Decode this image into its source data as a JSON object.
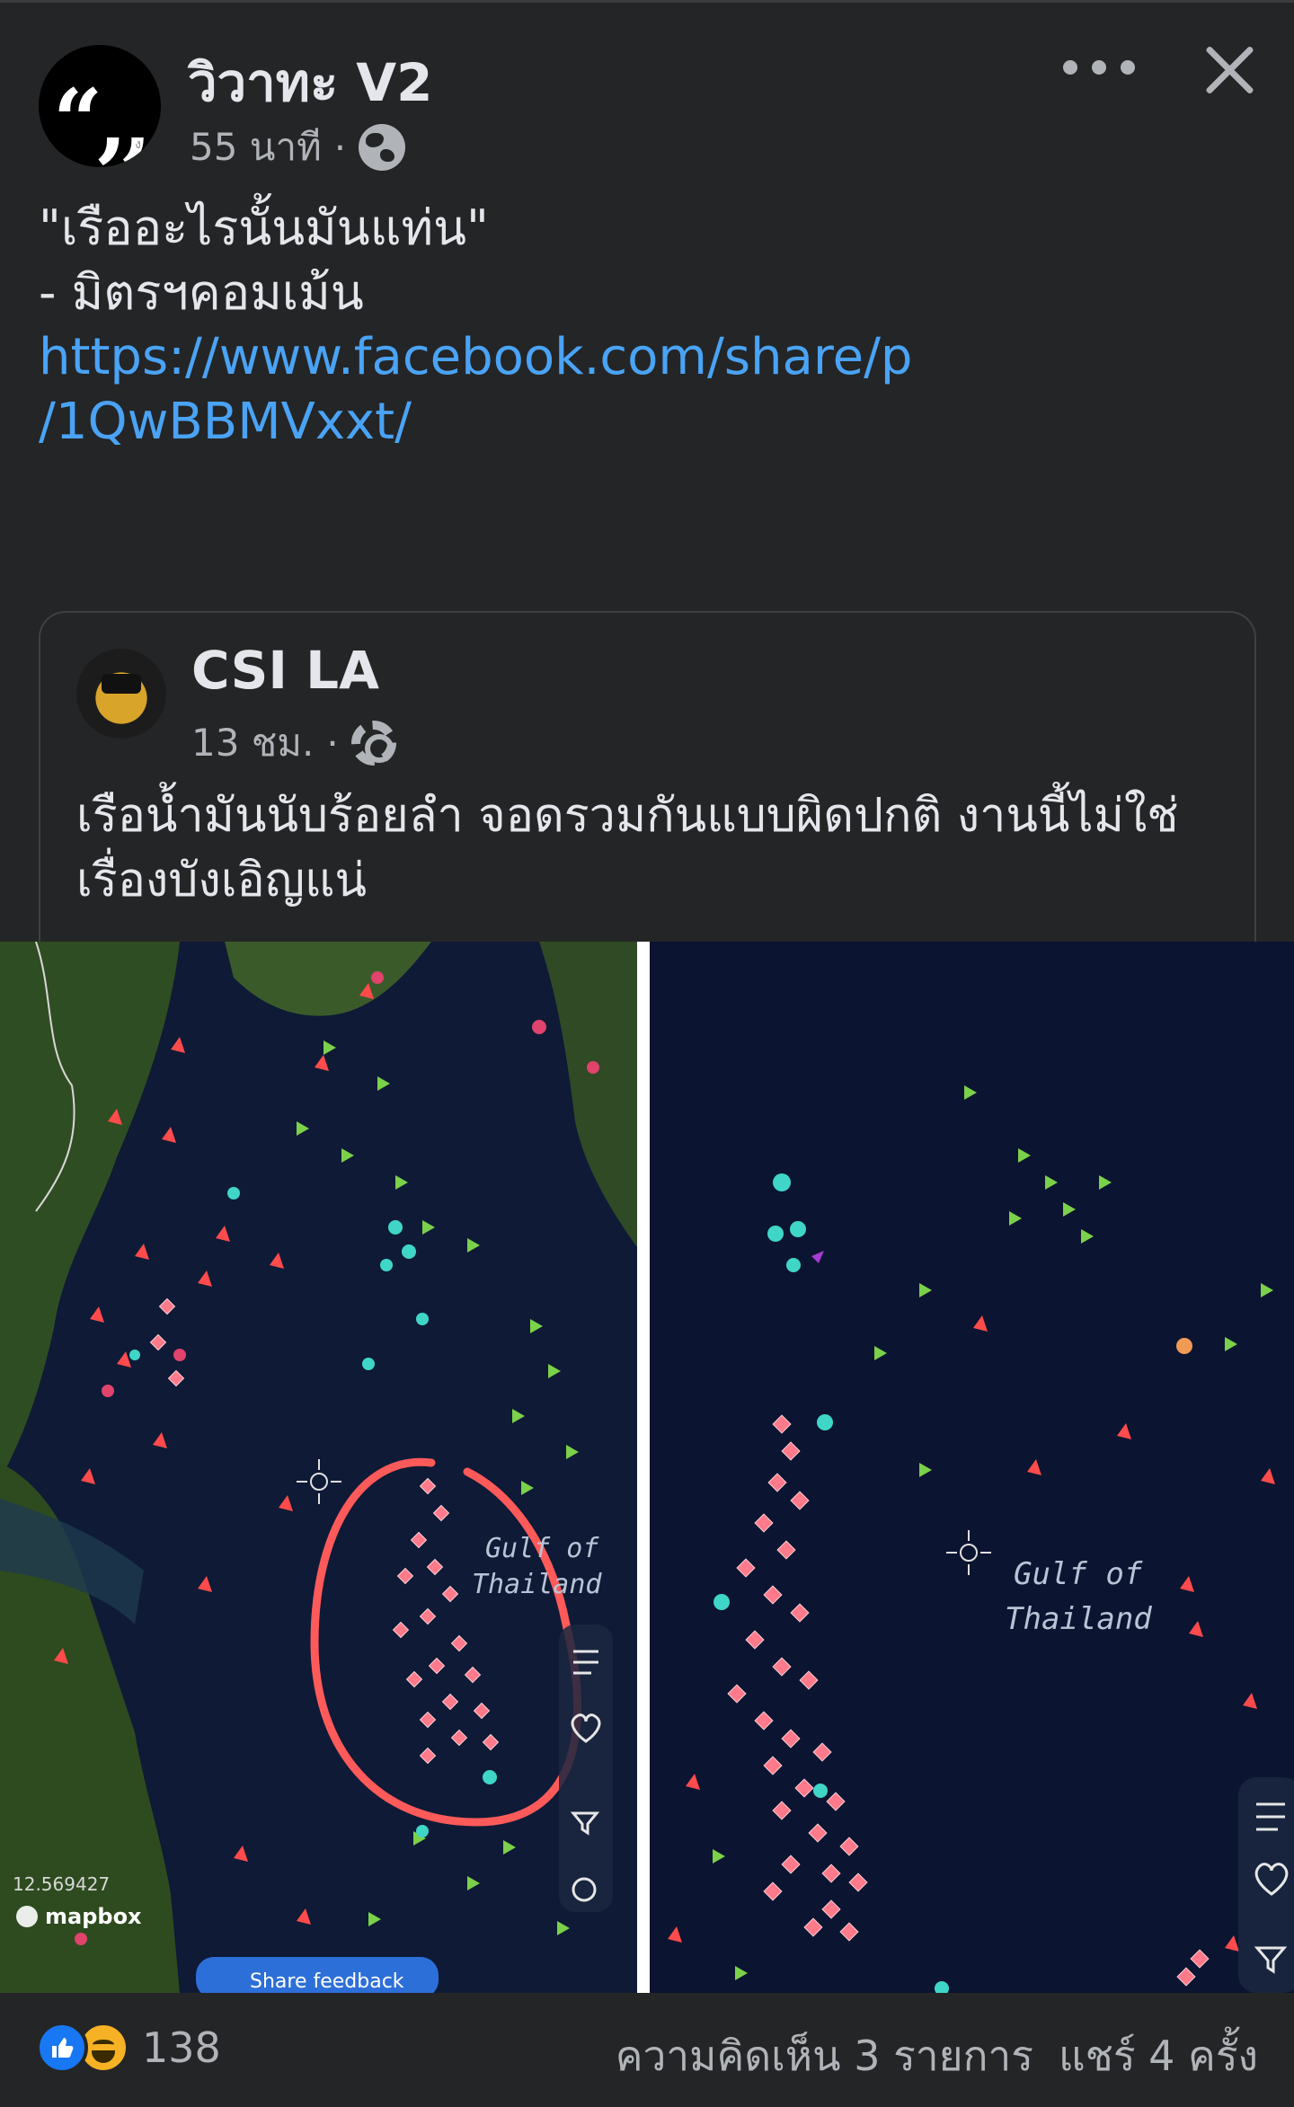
{
  "post": {
    "page_name": "วิวาทะ V2",
    "time": "55 นาที",
    "separator": "·",
    "avatar_text": "“,,",
    "body_lines": [
      "\"เรืออะไรนั้นมันแท่น\"",
      "",
      "- มิตรฯคอมเม้น",
      ""
    ],
    "link_line1": "https://www.facebook.com/share/p",
    "link_line2": "/1QwBBMVxxt/"
  },
  "shared_post": {
    "page_name": "CSI LA",
    "time": "13 ชม.",
    "separator": "·",
    "text": "เรือน้ำมันนับร้อยลำ จอดรวมกันแบบผิดปกติ งานนี้ไม่ใช่เรื่องบังเอิญแน่"
  },
  "map_left": {
    "label_line1": "Gulf of",
    "label_line2": "Thailand",
    "coordinate": "12.569427",
    "brand": "mapbox",
    "feedback_button": "Share feedback"
  },
  "map_right": {
    "label_line1": "Gulf of",
    "label_line2": "Thailand"
  },
  "footer": {
    "reaction_count": "138",
    "comments": "ความคิดเห็น 3 รายการ",
    "shares": "แชร์ 4 ครั้ง"
  },
  "icons": [
    "globe-icon",
    "more-icon",
    "close-icon",
    "gear-icon",
    "like-icon",
    "haha-icon"
  ],
  "colors": {
    "link": "#4aa3f5",
    "background": "#242526",
    "text": "#e4e6eb",
    "muted": "#b0b3b8",
    "circle": "#ff5a5a"
  }
}
